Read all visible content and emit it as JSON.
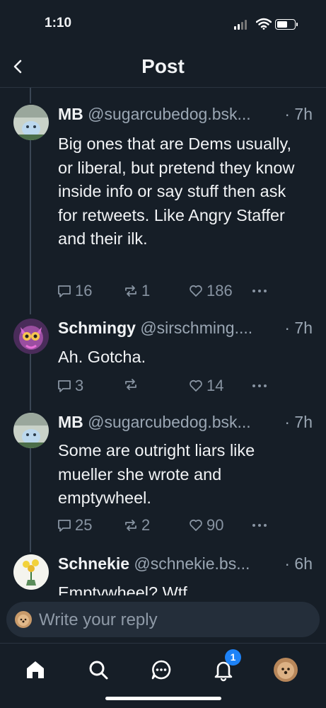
{
  "status": {
    "time": "1:10",
    "battery_level": 0.6
  },
  "header": {
    "title": "Post"
  },
  "posts": [
    {
      "name": "MB",
      "handle": "@sugarcubedog.bsk...",
      "time": "· 7h",
      "text": "Big ones that are Dems usually, or liberal, but pretend they know inside info or say stuff then ask for retweets. Like Angry Staffer and their ilk.",
      "replies": "16",
      "reposts": "1",
      "likes": "186"
    },
    {
      "name": "Schmingy",
      "handle": "@sirschming....",
      "time": "· 7h",
      "text": "Ah. Gotcha.",
      "replies": "3",
      "reposts": "",
      "likes": "14"
    },
    {
      "name": "MB",
      "handle": "@sugarcubedog.bsk...",
      "time": "· 7h",
      "text": "Some are outright liars like mueller she wrote and emptywheel.",
      "replies": "25",
      "reposts": "2",
      "likes": "90"
    },
    {
      "name": "Schnekie",
      "handle": "@schnekie.bs...",
      "time": "· 6h",
      "text": "Emptywheel? Wtf"
    }
  ],
  "reply": {
    "placeholder": "Write your reply"
  },
  "tabs": {
    "notification_count": "1"
  },
  "colors": {
    "background": "#161e27",
    "accent": "#1d82f7",
    "muted": "#8894a2"
  }
}
